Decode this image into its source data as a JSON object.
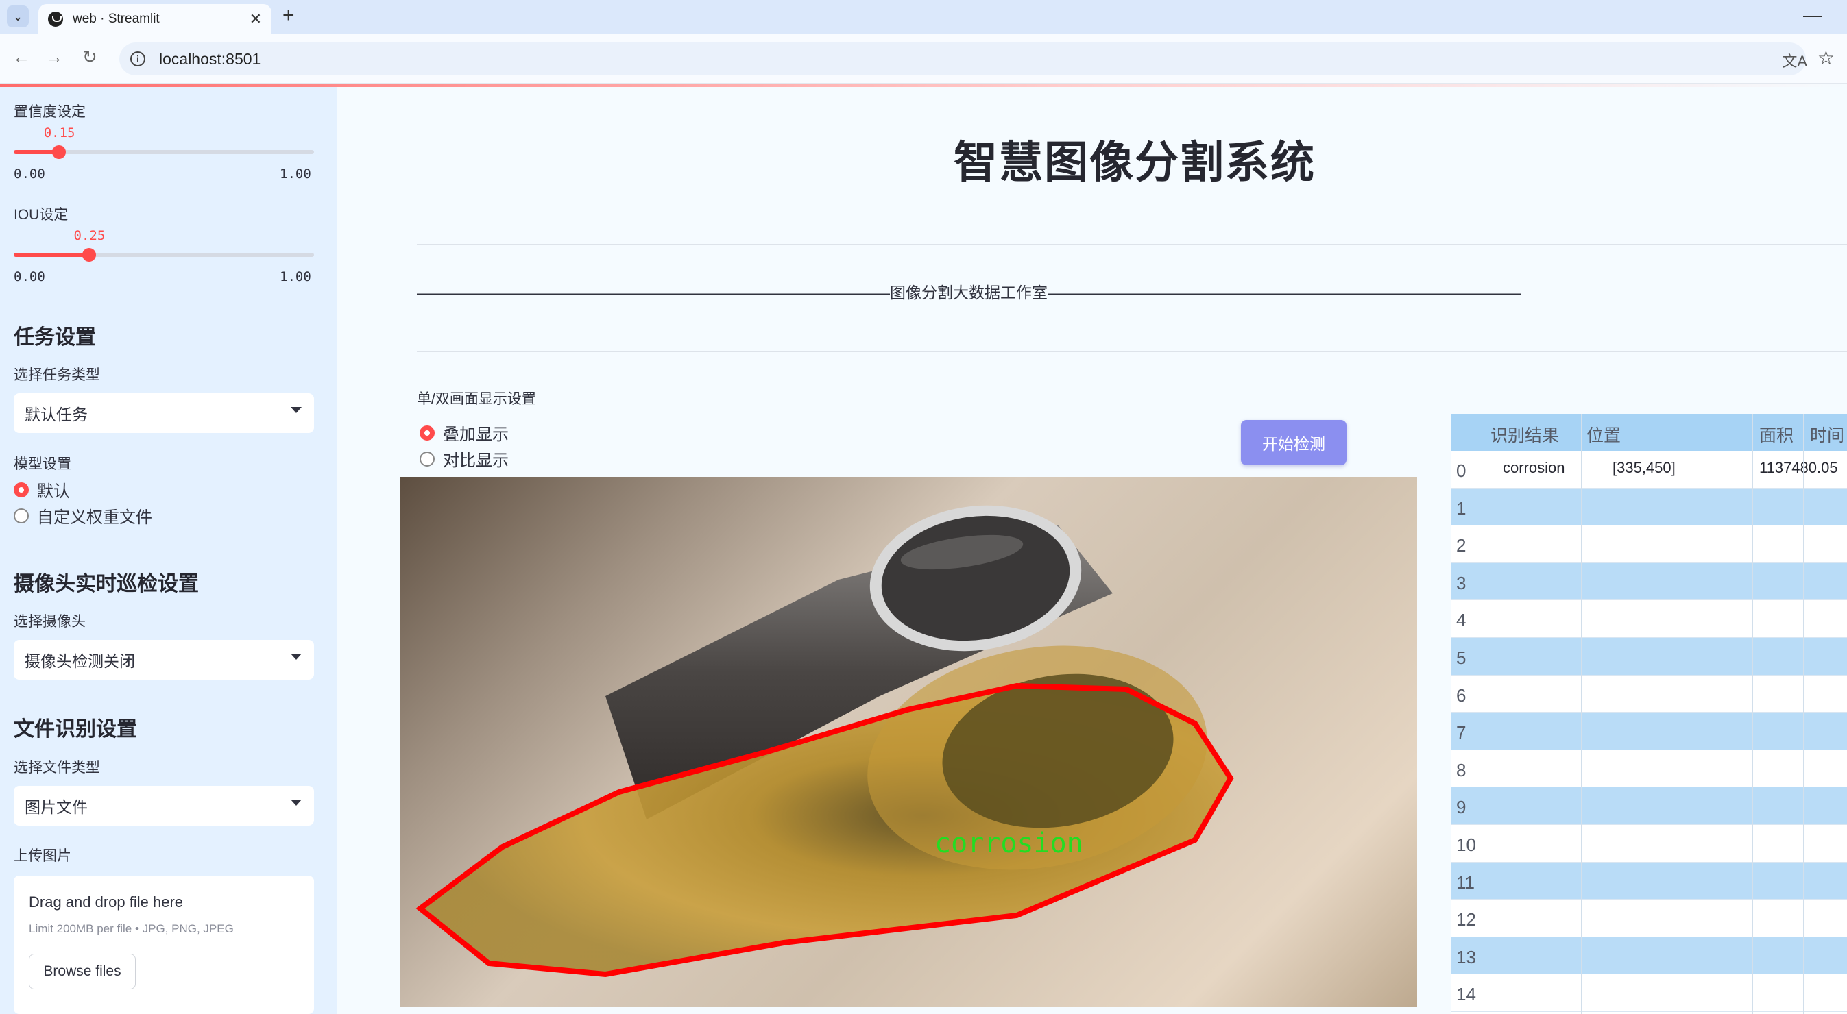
{
  "browser": {
    "tab_title": "web · Streamlit",
    "url": "localhost:8501"
  },
  "sidebar": {
    "confidence": {
      "label": "置信度设定",
      "value": "0.15",
      "fraction": 0.15,
      "min": "0.00",
      "max": "1.00"
    },
    "iou": {
      "label": "IOU设定",
      "value": "0.25",
      "fraction": 0.25,
      "min": "0.00",
      "max": "1.00"
    },
    "task_heading": "任务设置",
    "task_type_label": "选择任务类型",
    "task_type_value": "默认任务",
    "model_label": "模型设置",
    "model_options": [
      "默认",
      "自定义权重文件"
    ],
    "model_selected": 0,
    "camera_heading": "摄像头实时巡检设置",
    "camera_label": "选择摄像头",
    "camera_value": "摄像头检测关闭",
    "file_heading": "文件识别设置",
    "file_type_label": "选择文件类型",
    "file_type_value": "图片文件",
    "upload_label": "上传图片",
    "upload_title": "Drag and drop file here",
    "upload_limit": "Limit 200MB per file • JPG, PNG, JPEG",
    "browse_label": "Browse files"
  },
  "main": {
    "title": "智慧图像分割系统",
    "divider_text": "——————————————————————————————图像分割大数据工作室——————————————————————————————",
    "display_mode_label": "单/双画面显示设置",
    "display_options": [
      "叠加显示",
      "对比显示"
    ],
    "display_selected": 0,
    "detect_button": "开始检测",
    "overlay_label": "corrosion"
  },
  "results_table": {
    "columns": [
      "识别结果",
      "位置",
      "面积",
      "时间"
    ],
    "rows": [
      {
        "index": "0",
        "result": "corrosion",
        "position": "[335,450]",
        "area": "1137480.05"
      },
      {
        "index": "1"
      },
      {
        "index": "2"
      },
      {
        "index": "3"
      },
      {
        "index": "4"
      },
      {
        "index": "5"
      },
      {
        "index": "6"
      },
      {
        "index": "7"
      },
      {
        "index": "8"
      },
      {
        "index": "9"
      },
      {
        "index": "10"
      },
      {
        "index": "11"
      },
      {
        "index": "12"
      },
      {
        "index": "13"
      },
      {
        "index": "14"
      }
    ]
  },
  "colors": {
    "accent": "#ff4b4b",
    "button": "#8b8ff0",
    "sidebar_bg": "#e4f1ff",
    "mask_outline": "#ff0000",
    "label_green": "#22dd22"
  }
}
